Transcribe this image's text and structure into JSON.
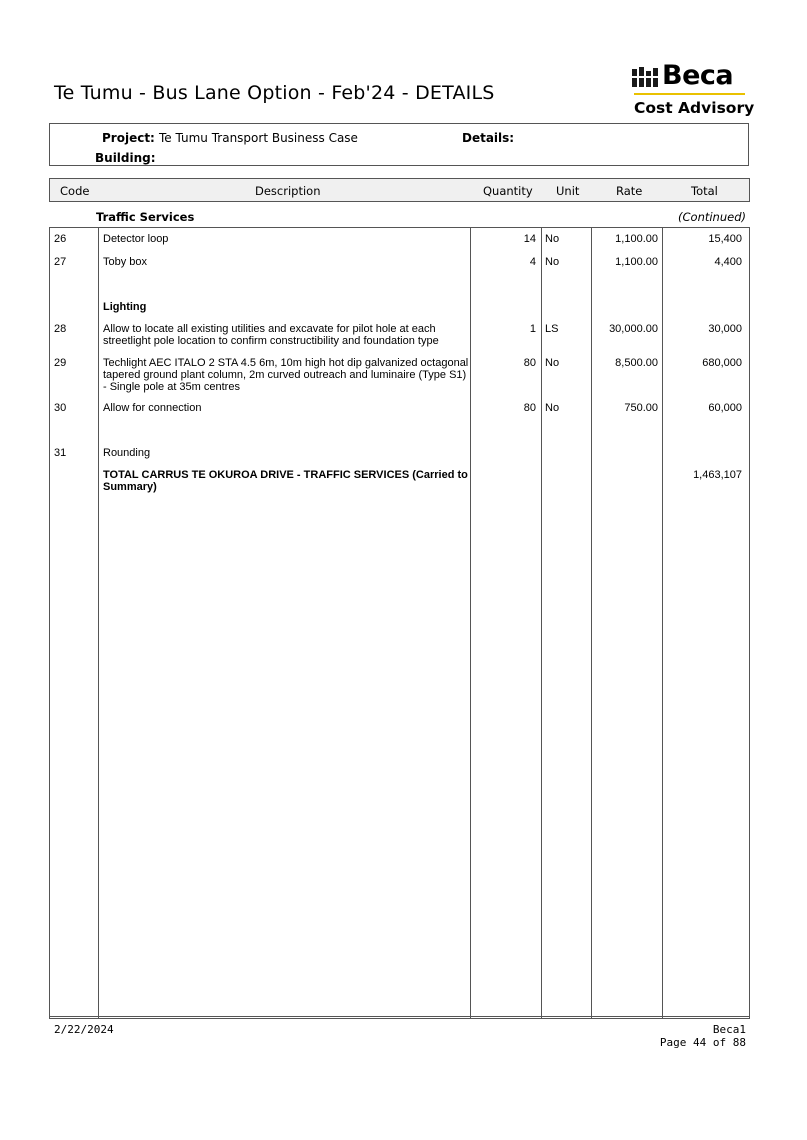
{
  "header": {
    "title": "Te Tumu - Bus Lane Option - Feb'24 - DETAILS",
    "logo_word": "Beca",
    "logo_sub": "Cost Advisory",
    "accent_color": "#e9c100"
  },
  "project": {
    "project_label": "Project:",
    "project_value": "Te Tumu Transport Business Case",
    "details_label": "Details:",
    "building_label": "Building:"
  },
  "columns": {
    "code": "Code",
    "description": "Description",
    "quantity": "Quantity",
    "unit": "Unit",
    "rate": "Rate",
    "total": "Total"
  },
  "section": {
    "title": "Traffic Services",
    "continued": "(Continued)"
  },
  "rows": [
    {
      "code": "26",
      "description": "Detector loop",
      "quantity": "14",
      "unit": "No",
      "rate": "1,100.00",
      "total": "15,400"
    },
    {
      "code": "27",
      "description": "Toby box",
      "quantity": "4",
      "unit": "No",
      "rate": "1,100.00",
      "total": "4,400"
    },
    {
      "code": "",
      "description": "Lighting",
      "quantity": "",
      "unit": "",
      "rate": "",
      "total": ""
    },
    {
      "code": "28",
      "description": "Allow to locate all existing utilities and excavate for pilot hole at each streetlight pole location to confirm constructibility and foundation type",
      "quantity": "1",
      "unit": "LS",
      "rate": "30,000.00",
      "total": "30,000"
    },
    {
      "code": "29",
      "description": "Techlight AEC ITALO 2 STA 4.5 6m, 10m high hot dip galvanized octagonal tapered ground plant column, 2m curved outreach and luminaire (Type S1) - Single pole at 35m centres",
      "quantity": "80",
      "unit": "No",
      "rate": "8,500.00",
      "total": "680,000"
    },
    {
      "code": "30",
      "description": "Allow for connection",
      "quantity": "80",
      "unit": "No",
      "rate": "750.00",
      "total": "60,000"
    },
    {
      "code": "31",
      "description": "Rounding",
      "quantity": "",
      "unit": "",
      "rate": "",
      "total": ""
    },
    {
      "code": "",
      "description": "TOTAL CARRUS TE OKUROA DRIVE  - TRAFFIC SERVICES (Carried to Summary)",
      "quantity": "",
      "unit": "",
      "rate": "",
      "total": "1,463,107"
    }
  ],
  "footer": {
    "date": "2/22/2024",
    "company": "Beca1",
    "page": "Page 44 of 88"
  }
}
